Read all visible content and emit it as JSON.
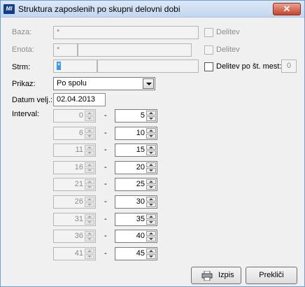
{
  "window": {
    "title": "Struktura zaposlenih po skupni delovni dobi",
    "app_icon_text": "MI",
    "close_glyph": "✕"
  },
  "fields": {
    "baza": {
      "label": "Baza:",
      "value": "*",
      "check_label": "Delitev",
      "checked": false
    },
    "enota": {
      "label": "Enota:",
      "value": "*",
      "value2": "",
      "check_label": "Delitev",
      "checked": false
    },
    "strm": {
      "label": "Strm:",
      "value": "*",
      "value2": "",
      "check_label": "Delitev po št. mest:",
      "checked": false,
      "count": "0"
    },
    "prikaz": {
      "label": "Prikaz:",
      "selected": "Po spolu"
    },
    "datum": {
      "label": "Datum velj.:",
      "value": "02.04.2013"
    },
    "interval": {
      "label": "Interval:"
    }
  },
  "intervals": [
    {
      "from": "0",
      "to": "5"
    },
    {
      "from": "6",
      "to": "10"
    },
    {
      "from": "11",
      "to": "15"
    },
    {
      "from": "16",
      "to": "20"
    },
    {
      "from": "21",
      "to": "25"
    },
    {
      "from": "26",
      "to": "30"
    },
    {
      "from": "31",
      "to": "35"
    },
    {
      "from": "36",
      "to": "40"
    },
    {
      "from": "41",
      "to": "45"
    }
  ],
  "dash": "-",
  "buttons": {
    "print_label": "Izpis",
    "cancel_label": "Prekliči"
  },
  "colors": {
    "title_bar": "#c3d7ef",
    "close": "#c7442b",
    "selection": "#3399ff",
    "dialog_bg": "#f0f0f0"
  }
}
